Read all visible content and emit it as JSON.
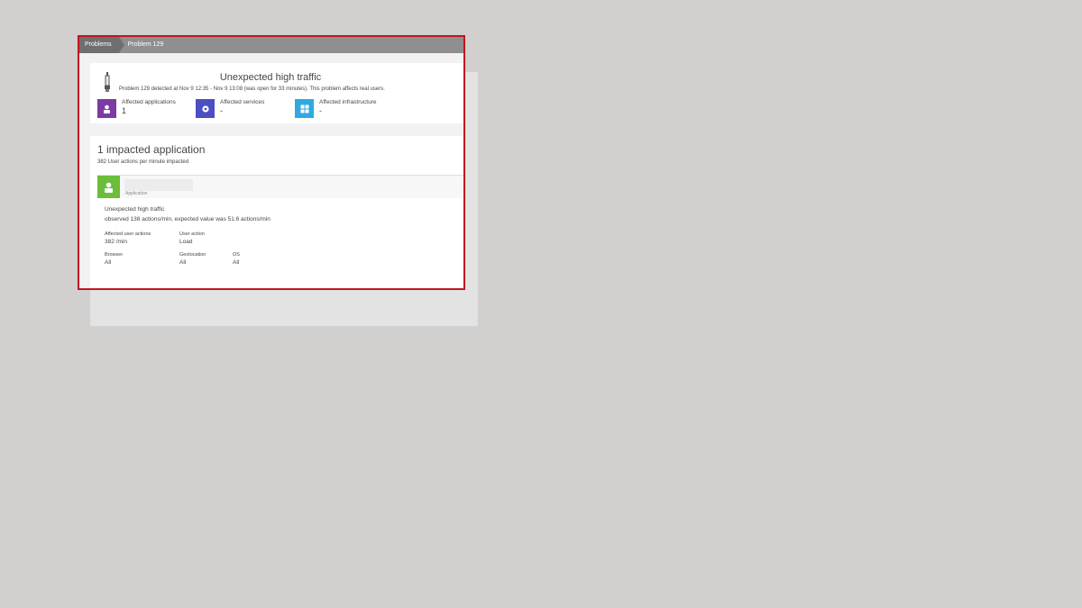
{
  "breadcrumb": {
    "items": [
      "Problems",
      "Problem 129"
    ]
  },
  "problem": {
    "title": "Unexpected high traffic",
    "subtitle": "Problem 129 detected at Nov 9 12:35 - Nov 9 13:08 (was open for 33 minutes). This problem affects real users."
  },
  "impacts": [
    {
      "label": "Affected applications",
      "value": "1",
      "color": "#7b3ba3",
      "icon": "user-icon"
    },
    {
      "label": "Affected services",
      "value": "-",
      "color": "#4b4fc3",
      "icon": "gear-icon"
    },
    {
      "label": "Affected infrastructure",
      "value": "-",
      "color": "#31a9e0",
      "icon": "grid-icon"
    }
  ],
  "impacted": {
    "heading": "1 impacted application",
    "subheading": "382 User actions per minute impacted"
  },
  "application": {
    "type_label": "Application",
    "avatar_color": "#6bbd3a",
    "event_title": "Unexpected high traffic",
    "event_desc": "observed 138 actions/min, expected value was 51.6 actions/min",
    "fields": {
      "affected_user_actions": {
        "label": "Affected user actions",
        "value": "382 /min"
      },
      "user_action": {
        "label": "User action",
        "value": "Load"
      },
      "browser": {
        "label": "Browser",
        "value": "All"
      },
      "geolocation": {
        "label": "Geolocation",
        "value": "All"
      },
      "os": {
        "label": "OS",
        "value": "All"
      }
    }
  }
}
